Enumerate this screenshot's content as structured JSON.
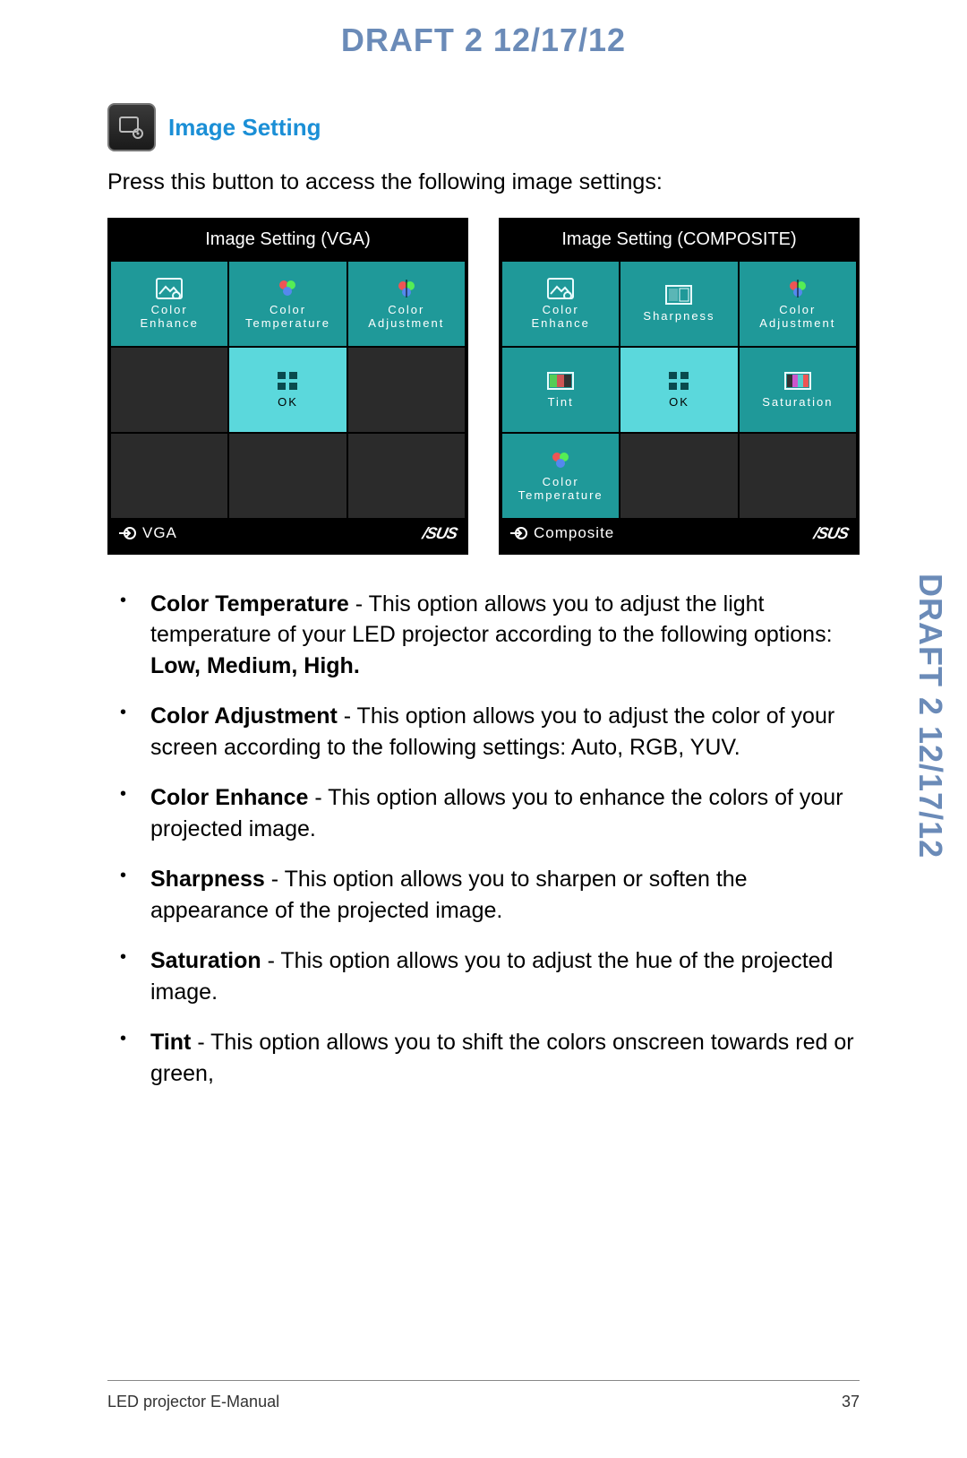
{
  "watermark": "DRAFT 2   12/17/12",
  "section": {
    "title": "Image Setting",
    "intro": "Press this button to access the following image settings:"
  },
  "menus": [
    {
      "title": "Image Setting (VGA)",
      "source": "VGA",
      "brand": "/SUS",
      "tiles": [
        {
          "label": "Color\nEnhance",
          "style": "teal",
          "icon": "picture"
        },
        {
          "label": "Color\nTemperature",
          "style": "teal",
          "icon": "palette"
        },
        {
          "label": "Color\nAdjustment",
          "style": "teal",
          "icon": "rgb"
        },
        {
          "label": "",
          "style": "empty",
          "icon": ""
        },
        {
          "label": "OK",
          "style": "cyan",
          "icon": "grid"
        },
        {
          "label": "",
          "style": "empty",
          "icon": ""
        },
        {
          "label": "",
          "style": "empty",
          "icon": ""
        },
        {
          "label": "",
          "style": "empty",
          "icon": ""
        },
        {
          "label": "",
          "style": "empty",
          "icon": ""
        }
      ]
    },
    {
      "title": "Image Setting (COMPOSITE)",
      "source": "Composite",
      "brand": "/SUS",
      "tiles": [
        {
          "label": "Color\nEnhance",
          "style": "teal",
          "icon": "picture"
        },
        {
          "label": "Sharpness",
          "style": "teal",
          "icon": "sharp"
        },
        {
          "label": "Color\nAdjustment",
          "style": "teal",
          "icon": "rgb"
        },
        {
          "label": "Tint",
          "style": "teal",
          "icon": "tint"
        },
        {
          "label": "OK",
          "style": "cyan",
          "icon": "grid"
        },
        {
          "label": "Saturation",
          "style": "teal",
          "icon": "sat"
        },
        {
          "label": "Color\nTemperature",
          "style": "teal",
          "icon": "palette"
        },
        {
          "label": "",
          "style": "empty",
          "icon": ""
        },
        {
          "label": "",
          "style": "empty",
          "icon": ""
        }
      ]
    }
  ],
  "descriptions": [
    {
      "term": "Color Temperature",
      "text": " - This option allows you to adjust the light temperature of your LED projector according to the following options: ",
      "opts": "Low, Medium, High."
    },
    {
      "term": "Color Adjustment",
      "text": " - This option allows you to adjust the color of your screen according to the following settings: Auto, RGB, YUV.",
      "opts": ""
    },
    {
      "term": "Color Enhance",
      "text": " - This option allows you to enhance the colors of your projected image.",
      "opts": ""
    },
    {
      "term": "Sharpness",
      "text": " - This option allows you to sharpen or soften the appearance of the projected image.",
      "opts": ""
    },
    {
      "term": "Saturation",
      "text": " - This option allows you to adjust the hue of the projected image.",
      "opts": ""
    },
    {
      "term": "Tint",
      "text": " - This option allows you to shift the colors onscreen towards red or green,",
      "opts": ""
    }
  ],
  "footer": {
    "text": "LED projector E-Manual",
    "page": "37"
  }
}
